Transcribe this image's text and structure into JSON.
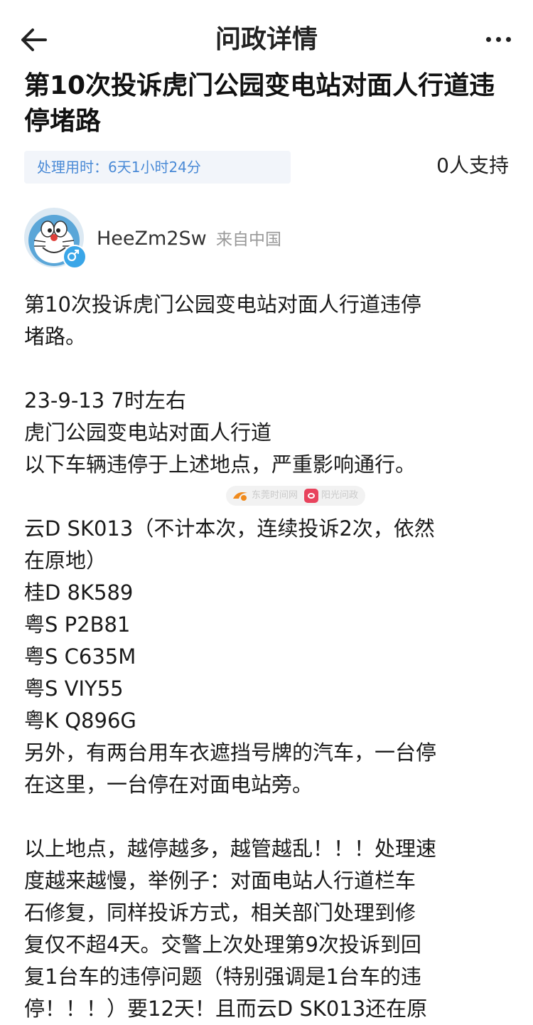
{
  "header": {
    "title": "问政详情",
    "back_icon": "arrow-left-icon",
    "more_icon": "more-horizontal-icon"
  },
  "post": {
    "headline": "第10次投诉虎门公园变电站对面人行道违停堵路",
    "processing_time_label": "处理用时：",
    "processing_time_value": "6天1小时24分",
    "support_count": "0人支持"
  },
  "author": {
    "name": "HeeZm2Sw",
    "origin": "来自中国",
    "gender_icon": "male-icon"
  },
  "watermark": {
    "text1": "东莞时间网",
    "text2": "阳光问政"
  },
  "body_lines": [
    "第10次投诉虎门公园变电站对面人行道违停",
    "堵路。",
    "",
    "23-9-13 7时左右",
    "虎门公园变电站对面人行道",
    "以下车辆违停于上述地点，严重影响通行。",
    "",
    "云D SK013（不计本次，连续投诉2次，依然",
    "在原地）",
    "桂D 8K589",
    "粤S P2B81",
    "粤S C635M",
    "粤S VIY55",
    "粤K Q896G",
    "另外，有两台用车衣遮挡号牌的汽车，一台停",
    "在这里，一台停在对面电站旁。",
    "",
    "以上地点，越停越多，越管越乱！！！处理速",
    "度越来越慢，举例子：对面电站人行道栏车",
    "石修复，同样投诉方式，相关部门处理到修",
    "复仅不超4天。交警上次处理第9次投诉到回",
    "复1台车的违停问题（特别强调是1台车的违",
    "停！！！）要12天！且而云D SK013还在原"
  ],
  "colors": {
    "accent_blue": "#4a8ad6",
    "badge_bg": "#f2f5fa",
    "gender_blue": "#3aa6e8"
  }
}
